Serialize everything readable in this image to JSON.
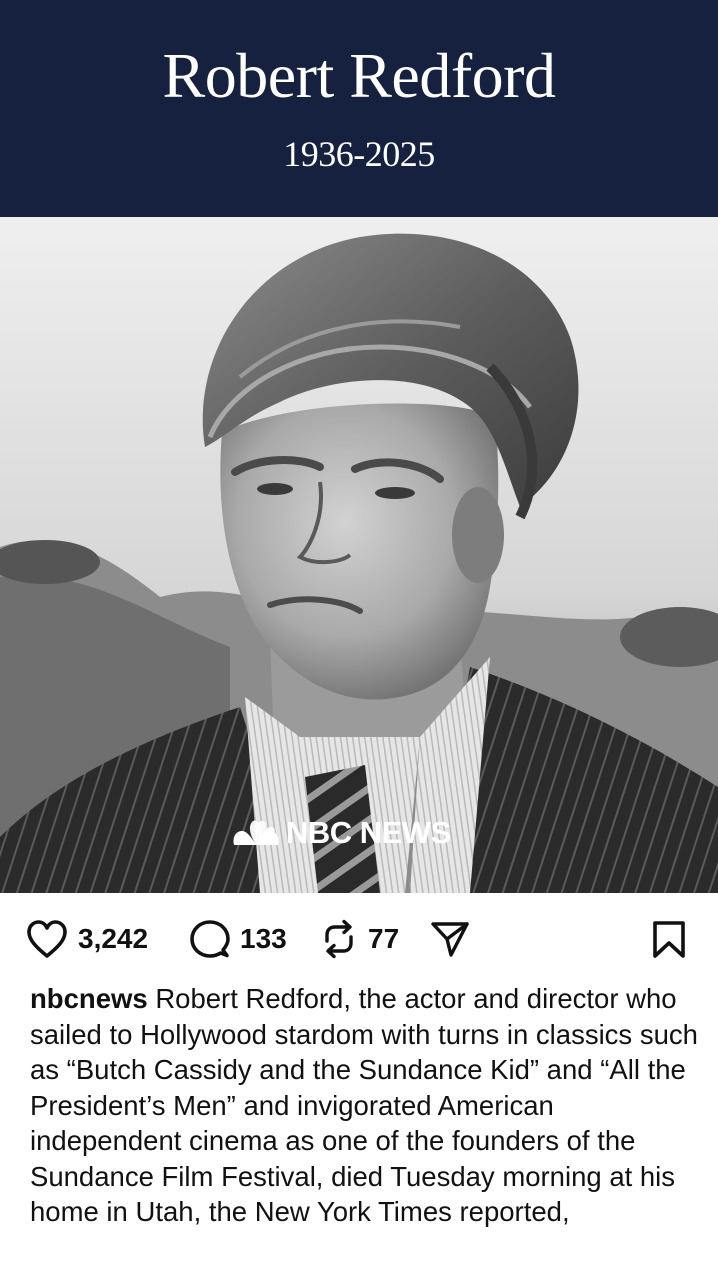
{
  "banner": {
    "name": "Robert Redford",
    "years": "1936-2025",
    "background": "#15213f"
  },
  "photo": {
    "watermark_icon": "nbc-peacock-icon",
    "watermark_text": "NBC NEWS"
  },
  "actions": {
    "likes": "3,242",
    "comments": "133",
    "reposts": "77",
    "icons": [
      "heart-icon",
      "comment-icon",
      "repost-icon",
      "share-icon",
      "bookmark-icon"
    ]
  },
  "caption": {
    "username": "nbcnews",
    "text": "Robert Redford, the actor and director who sailed to Hollywood stardom with turns in classics such as “Butch Cassidy and the Sundance Kid” and “All the President’s Men” and invigorated American independent cinema as one of the founders of the Sundance Film Festival, died Tuesday morning at his home in Utah, the New York Times reported,"
  }
}
